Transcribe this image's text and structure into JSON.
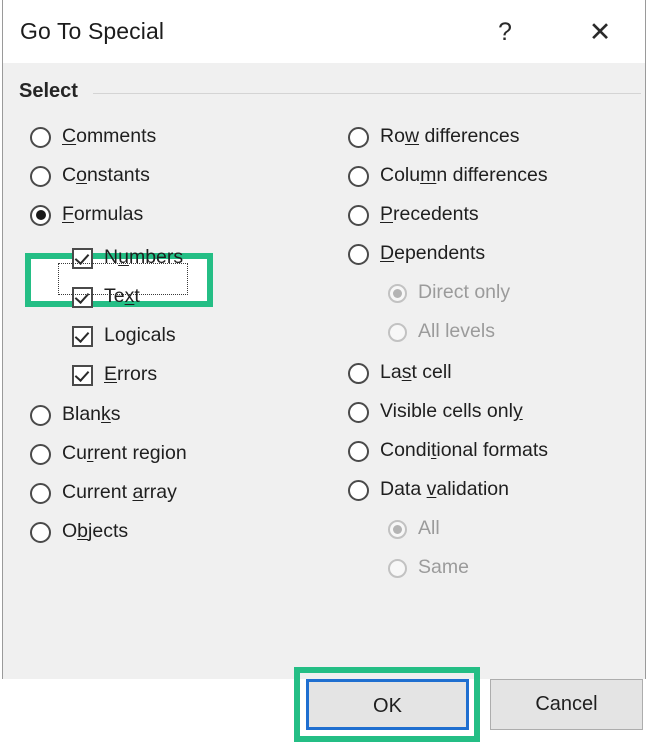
{
  "dialog": {
    "title": "Go To Special",
    "help_icon": "?",
    "close_icon": "✕",
    "group_label": "Select"
  },
  "left_column": [
    {
      "type": "radio",
      "label": "Comments",
      "acc": "C",
      "checked": false,
      "enabled": true,
      "indent": 0
    },
    {
      "type": "radio",
      "label": "Constants",
      "acc": "o",
      "checked": false,
      "enabled": true,
      "indent": 0
    },
    {
      "type": "radio",
      "label": "Formulas",
      "acc": "F",
      "checked": true,
      "enabled": true,
      "indent": 0,
      "focused": true,
      "highlighted": true
    },
    {
      "type": "checkbox",
      "label": "Numbers",
      "acc": "u",
      "checked": true,
      "enabled": true,
      "indent": 1
    },
    {
      "type": "checkbox",
      "label": "Text",
      "acc": "x",
      "checked": true,
      "enabled": true,
      "indent": 1
    },
    {
      "type": "checkbox",
      "label": "Logicals",
      "acc": "g",
      "checked": true,
      "enabled": true,
      "indent": 1
    },
    {
      "type": "checkbox",
      "label": "Errors",
      "acc": "E",
      "checked": true,
      "enabled": true,
      "indent": 1
    },
    {
      "type": "radio",
      "label": "Blanks",
      "acc": "k",
      "checked": false,
      "enabled": true,
      "indent": 0
    },
    {
      "type": "radio",
      "label": "Current region",
      "acc": "r",
      "checked": false,
      "enabled": true,
      "indent": 0
    },
    {
      "type": "radio",
      "label": "Current array",
      "acc": "a",
      "checked": false,
      "enabled": true,
      "indent": 0
    },
    {
      "type": "radio",
      "label": "Objects",
      "acc": "b",
      "checked": false,
      "enabled": true,
      "indent": 0
    }
  ],
  "right_column": [
    {
      "type": "radio",
      "label": "Row differences",
      "acc": "w",
      "checked": false,
      "enabled": true,
      "indent": 0
    },
    {
      "type": "radio",
      "label": "Column differences",
      "acc": "m",
      "checked": false,
      "enabled": true,
      "indent": 0
    },
    {
      "type": "radio",
      "label": "Precedents",
      "acc": "P",
      "checked": false,
      "enabled": true,
      "indent": 0
    },
    {
      "type": "radio",
      "label": "Dependents",
      "acc": "D",
      "checked": false,
      "enabled": true,
      "indent": 0
    },
    {
      "type": "radio",
      "label": "Direct only",
      "acc": "",
      "checked": true,
      "enabled": false,
      "indent": 1
    },
    {
      "type": "radio",
      "label": "All levels",
      "acc": "",
      "checked": false,
      "enabled": false,
      "indent": 1
    },
    {
      "type": "radio",
      "label": "Last cell",
      "acc": "s",
      "checked": false,
      "enabled": true,
      "indent": 0
    },
    {
      "type": "radio",
      "label": "Visible cells only",
      "acc": "y",
      "checked": false,
      "enabled": true,
      "indent": 0
    },
    {
      "type": "radio",
      "label": "Conditional formats",
      "acc": "t",
      "checked": false,
      "enabled": true,
      "indent": 0
    },
    {
      "type": "radio",
      "label": "Data validation",
      "acc": "v",
      "checked": false,
      "enabled": true,
      "indent": 0
    },
    {
      "type": "radio",
      "label": "All",
      "acc": "",
      "checked": true,
      "enabled": false,
      "indent": 1
    },
    {
      "type": "radio",
      "label": "Same",
      "acc": "",
      "checked": false,
      "enabled": false,
      "indent": 1
    }
  ],
  "buttons": {
    "ok_label": "OK",
    "cancel_label": "Cancel"
  },
  "annotations": {
    "highlight_color": "#24be85",
    "focus_border_color": "#1f6fd0",
    "highlighted_items": [
      "Formulas",
      "OK"
    ]
  }
}
